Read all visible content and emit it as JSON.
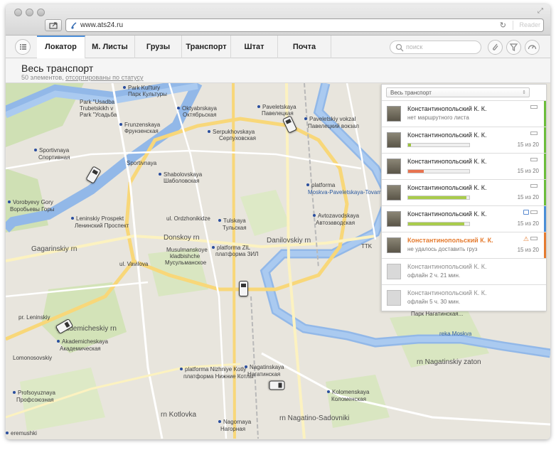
{
  "browser": {
    "url": "www.ats24.ru",
    "reader_label": "Reader"
  },
  "tabs": [
    {
      "label": "Локатор",
      "active": true
    },
    {
      "label": "М. Листы",
      "active": false
    },
    {
      "label": "Грузы",
      "active": false
    },
    {
      "label": "Транспорт",
      "active": false
    },
    {
      "label": "Штат",
      "active": false
    },
    {
      "label": "Почта",
      "active": false
    }
  ],
  "search": {
    "placeholder": "поиск"
  },
  "header": {
    "title": "Весь транспорт",
    "count_text": "50 элементов,",
    "sort_link": "отсортированы по статусу"
  },
  "panel": {
    "filter_value": "Весь транспорт",
    "rows": [
      {
        "name": "Константинопольский К. К.",
        "sub": "нет маршрутного листа",
        "count": "",
        "progress": null,
        "status_color": "#6cbd3a"
      },
      {
        "name": "Константинопольский К. К.",
        "sub": "",
        "count": "15 из 20",
        "progress": 0.05,
        "bar_color": "#9bc33c",
        "status_color": "#6cbd3a"
      },
      {
        "name": "Константинопольский К. К.",
        "sub": "",
        "count": "15 из 20",
        "progress": 0.25,
        "bar_color": "#e8734f",
        "status_color": "#6cbd3a"
      },
      {
        "name": "Константинопольский К. К.",
        "sub": "",
        "count": "15 из 20",
        "progress": 0.95,
        "bar_color": "#a9cc4c",
        "status_color": "#6cbd3a"
      },
      {
        "name": "Константинопольский К. К.",
        "sub": "",
        "count": "15 из 20",
        "progress": 0.92,
        "bar_color": "#a9cc4c",
        "status_color": "#4a8fd6"
      },
      {
        "name": "Константинопольский К. К.",
        "sub": "не удалось доставить груз",
        "count": "15 из 20",
        "progress": null,
        "status_color": "#e57b2f",
        "alert": true
      },
      {
        "name": "Константинопольский К. К.",
        "sub": "офлайн 2 ч. 21 мин.",
        "count": "",
        "progress": null,
        "status_color": "",
        "offline": true
      },
      {
        "name": "Константинопольский К. К.",
        "sub": "офлайн 5 ч. 30 мин.",
        "count": "",
        "progress": null,
        "status_color": "",
        "offline": true
      }
    ]
  },
  "map": {
    "labels": [
      {
        "text": "Park Kul'tury",
        "kind": "metro"
      },
      {
        "text": "Парк Культуры",
        "kind": ""
      },
      {
        "text": "Park \"Usadba",
        "kind": ""
      },
      {
        "text": "Trubetskikh v",
        "kind": ""
      },
      {
        "text": "Park \"Усадьба",
        "kind": ""
      },
      {
        "text": "Frunzenskaya",
        "kind": "metro"
      },
      {
        "text": "Фрунзенская",
        "kind": ""
      },
      {
        "text": "Oktyabrskaya",
        "kind": "metro"
      },
      {
        "text": "Октябрьская",
        "kind": ""
      },
      {
        "text": "Paveletskaya",
        "kind": "metro"
      },
      {
        "text": "Павелецкая",
        "kind": ""
      },
      {
        "text": "Paveletskiy vokzal",
        "kind": "metro"
      },
      {
        "text": "Павелецкий вокзал",
        "kind": ""
      },
      {
        "text": "Serpukhovskaya",
        "kind": "metro"
      },
      {
        "text": "Серпуховская",
        "kind": ""
      },
      {
        "text": "Sportivnaya",
        "kind": "metro"
      },
      {
        "text": "Спортивная",
        "kind": ""
      },
      {
        "text": "Shabolovskaya",
        "kind": "metro"
      },
      {
        "text": "Шаболовская",
        "kind": ""
      },
      {
        "text": "platforma",
        "kind": "metro"
      },
      {
        "text": "Moskva-Paveletskaya-Tovarn",
        "kind": "blue"
      },
      {
        "text": "Vorobyevy Gory",
        "kind": "metro"
      },
      {
        "text": "Воробьевы Горы",
        "kind": ""
      },
      {
        "text": "Leninskiy Prospekt",
        "kind": "metro"
      },
      {
        "text": "Ленинский Проспект",
        "kind": ""
      },
      {
        "text": "Avtozavodskaya",
        "kind": "metro"
      },
      {
        "text": "Автозаводская",
        "kind": ""
      },
      {
        "text": "Tulskaya",
        "kind": "metro"
      },
      {
        "text": "Тульская",
        "kind": ""
      },
      {
        "text": "Donskoy rn",
        "kind": "big"
      },
      {
        "text": "Danilovskiy rn",
        "kind": "big"
      },
      {
        "text": "Gagarinskiy rn",
        "kind": "big"
      },
      {
        "text": "Musulmanskoye",
        "kind": ""
      },
      {
        "text": "kladbishche",
        "kind": ""
      },
      {
        "text": "Мусульманское",
        "kind": ""
      },
      {
        "text": "platforma ZIL",
        "kind": "metro"
      },
      {
        "text": "платформа ЗИЛ",
        "kind": ""
      },
      {
        "text": "Akademicheskiy rn",
        "kind": "big"
      },
      {
        "text": "Akademicheskaya",
        "kind": "metro"
      },
      {
        "text": "Академическая",
        "kind": ""
      },
      {
        "text": "platforma Nizhniye Kotly",
        "kind": "metro"
      },
      {
        "text": "платформа Нижние Котлы",
        "kind": ""
      },
      {
        "text": "Nagatinskaya",
        "kind": "metro"
      },
      {
        "text": "Нагатинская",
        "kind": ""
      },
      {
        "text": "Profsoyuznaya",
        "kind": "metro"
      },
      {
        "text": "Профсоюзная",
        "kind": ""
      },
      {
        "text": "rn Kotlovka",
        "kind": "big"
      },
      {
        "text": "Nagornaya",
        "kind": "metro"
      },
      {
        "text": "Нагорная",
        "kind": ""
      },
      {
        "text": "rn Nagatino-Sadovniki",
        "kind": "big"
      },
      {
        "text": "Kolomenskaya",
        "kind": "metro"
      },
      {
        "text": "Коломенская",
        "kind": ""
      },
      {
        "text": "rn Nagatinskiy zaton",
        "kind": "big"
      },
      {
        "text": "reka Moskva",
        "kind": "blue"
      },
      {
        "text": "Парк Нагатинская...",
        "kind": ""
      },
      {
        "text": "ul. Ordzhonikidze",
        "kind": ""
      },
      {
        "text": "ul. Vavilova",
        "kind": ""
      },
      {
        "text": "Lomonosovskiy",
        "kind": ""
      },
      {
        "text": "pr. Leninskiy",
        "kind": ""
      },
      {
        "text": "Sportivnaya",
        "kind": ""
      },
      {
        "text": "TTK",
        "kind": ""
      },
      {
        "text": "eremushki",
        "kind": "metro"
      }
    ]
  }
}
